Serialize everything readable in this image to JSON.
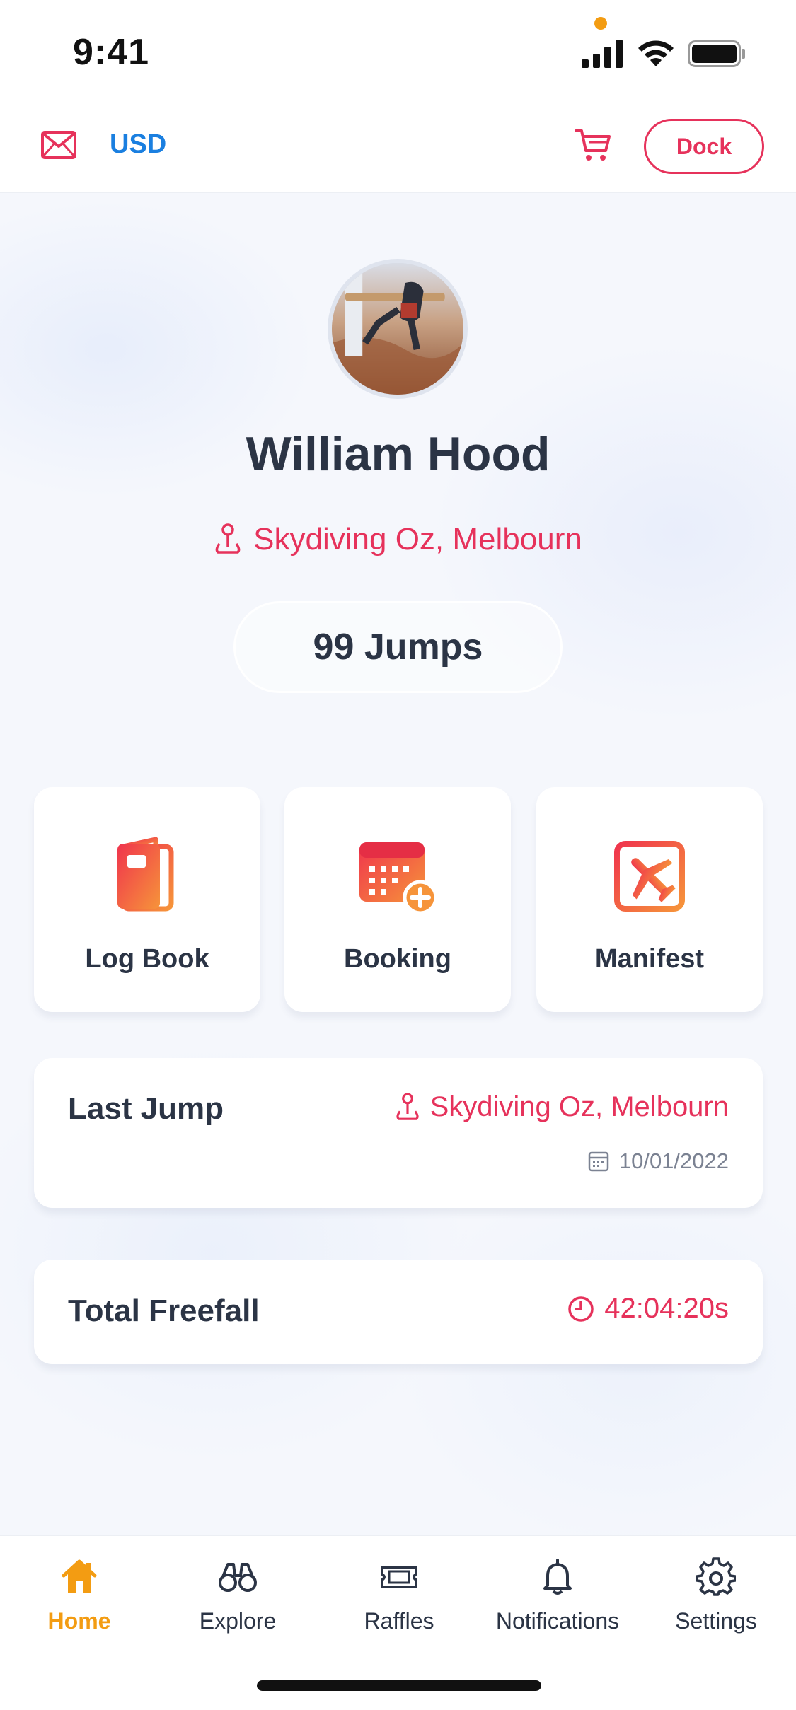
{
  "status_bar": {
    "time": "9:41"
  },
  "header": {
    "currency": "USD",
    "dock_label": "Dock",
    "icons": [
      "mail-icon",
      "cart-icon"
    ]
  },
  "profile": {
    "name": "William Hood",
    "location": "Skydiving Oz, Melbourn",
    "jumps": "99 Jumps"
  },
  "tiles": [
    {
      "label": "Log Book",
      "icon": "log-book-icon"
    },
    {
      "label": "Booking",
      "icon": "booking-calendar-icon"
    },
    {
      "label": "Manifest",
      "icon": "manifest-plane-icon"
    }
  ],
  "last_jump": {
    "title": "Last Jump",
    "location": "Skydiving Oz, Melbourn",
    "date": "10/01/2022"
  },
  "total_freefall": {
    "title": "Total Freefall",
    "time": "42:04:20s"
  },
  "nav": [
    {
      "label": "Home",
      "icon": "home-icon",
      "active": true
    },
    {
      "label": "Explore",
      "icon": "binoculars-icon",
      "active": false
    },
    {
      "label": "Raffles",
      "icon": "ticket-icon",
      "active": false
    },
    {
      "label": "Notifications",
      "icon": "bell-icon",
      "active": false
    },
    {
      "label": "Settings",
      "icon": "gear-icon",
      "active": false
    }
  ],
  "colors": {
    "accent": "#e6325b",
    "link": "#1a7fe0",
    "active_nav": "#f39c12",
    "text": "#2b3445"
  }
}
